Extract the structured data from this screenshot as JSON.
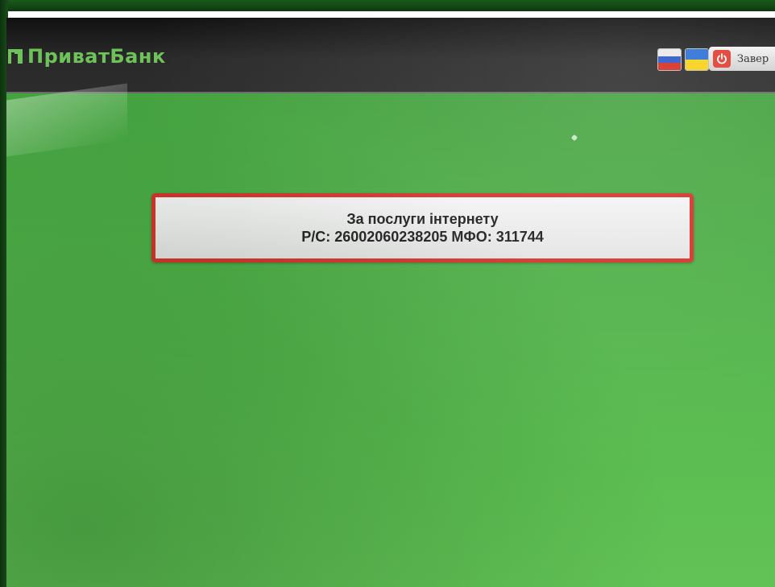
{
  "header": {
    "bank_name": "ПриватБанк",
    "exit_label": "Завер",
    "language_flags": [
      {
        "name": "russian-flag",
        "colors": [
          "#ffffff",
          "#2a55c9",
          "#d52b1e"
        ]
      },
      {
        "name": "ukrainian-flag",
        "colors": [
          "#2a6fd6",
          "#f7d116"
        ]
      }
    ]
  },
  "payment_info": {
    "line1": "За послуги інтернету",
    "line2": "Р/С: 26002060238205 МФО: 311744"
  },
  "colors": {
    "screen_green": "#4eae47",
    "logo_green": "#6dc35a",
    "highlight_border": "#d6332b",
    "power_red": "#e23b2f"
  }
}
